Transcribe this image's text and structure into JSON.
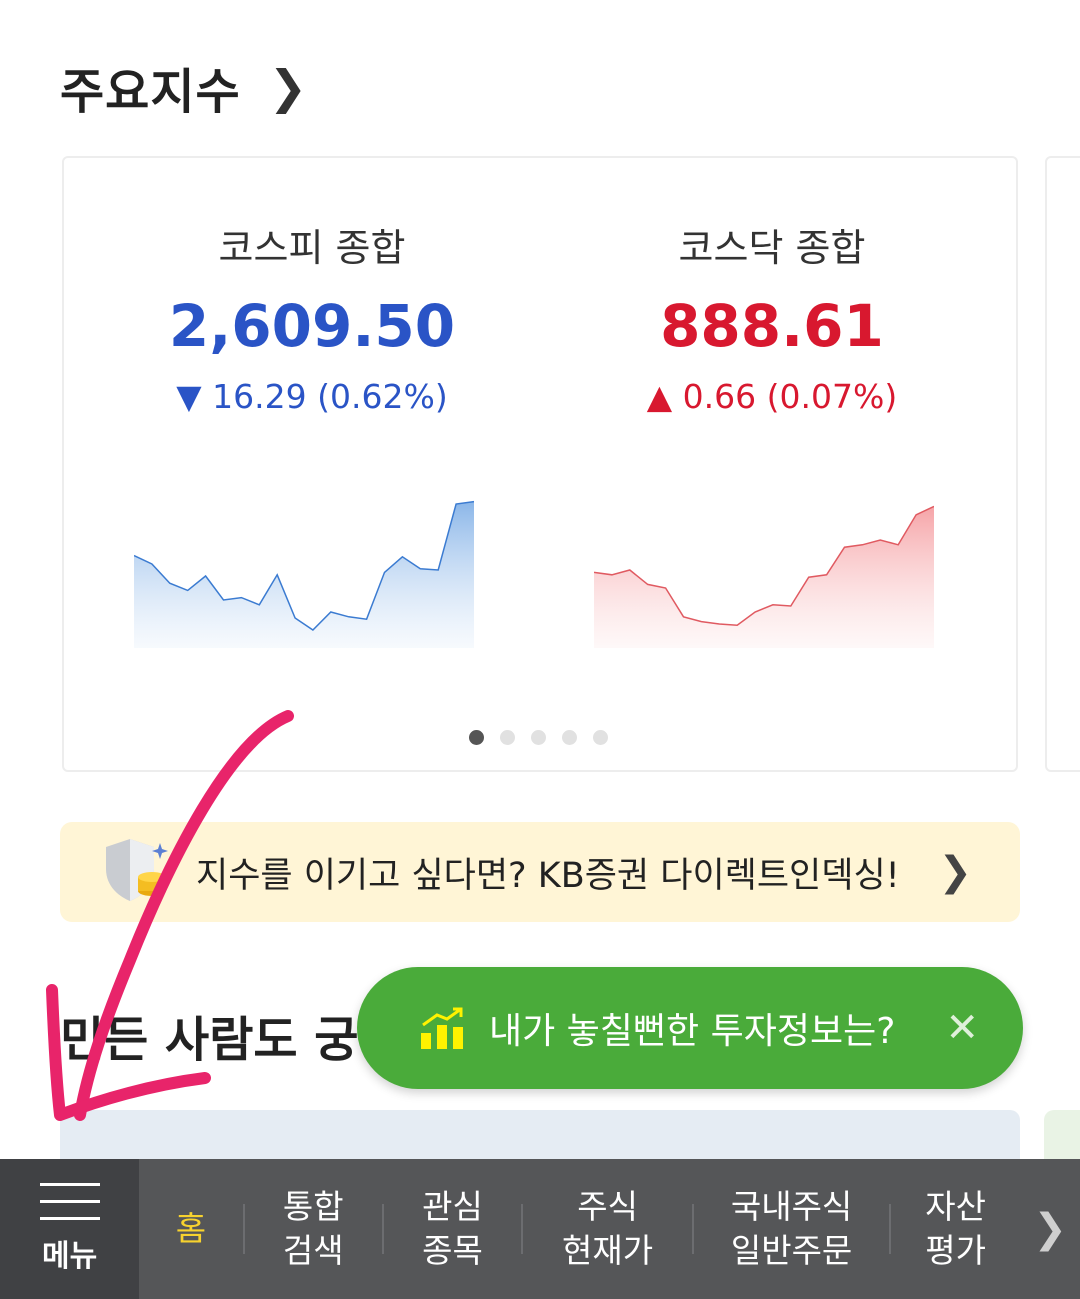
{
  "section": {
    "title": "주요지수"
  },
  "indices": [
    {
      "name": "코스피 종합",
      "value": "2,609.50",
      "change_text": "16.29 (0.62%)",
      "direction": "down",
      "color": "#2a54c6",
      "sparkline": [
        0.57,
        0.5,
        0.34,
        0.28,
        0.4,
        0.2,
        0.22,
        0.16,
        0.41,
        0.05,
        -0.05,
        0.1,
        0.06,
        0.04,
        0.43,
        0.56,
        0.46,
        0.45,
        1.0,
        1.02
      ]
    },
    {
      "name": "코스닥 종합",
      "value": "888.61",
      "change_text": "0.66 (0.07%)",
      "direction": "up",
      "color": "#d8182f",
      "sparkline": [
        0.43,
        0.41,
        0.45,
        0.33,
        0.3,
        0.06,
        0.02,
        0.0,
        -0.01,
        0.1,
        0.16,
        0.15,
        0.39,
        0.41,
        0.64,
        0.66,
        0.7,
        0.66,
        0.91,
        0.98
      ]
    }
  ],
  "carousel": {
    "pages": 5,
    "active": 0
  },
  "promo": {
    "text": "지수를 이기고 싶다면? KB증권 다이렉트인덱싱!",
    "icon": "shield-coin-icon"
  },
  "section2": {
    "title": "민든 사람도 궁"
  },
  "toast": {
    "text": "내가 놓칠뻔한 투자정보는?",
    "icon": "bar-chart-icon",
    "close_icon": "close-icon"
  },
  "bottom_nav": {
    "menu_label": "메뉴",
    "items": [
      {
        "line1": "홈",
        "line2": "",
        "active": true
      },
      {
        "line1": "통합",
        "line2": "검색",
        "active": false
      },
      {
        "line1": "관심",
        "line2": "종목",
        "active": false
      },
      {
        "line1": "주식",
        "line2": "현재가",
        "active": false
      },
      {
        "line1": "국내주식",
        "line2": "일반주문",
        "active": false
      },
      {
        "line1": "자산",
        "line2": "평가",
        "active": false
      }
    ]
  },
  "colors": {
    "accent_yellow": "#f7d22e",
    "toast_green": "#4aab3a",
    "annotation_pink": "#e8246a"
  }
}
